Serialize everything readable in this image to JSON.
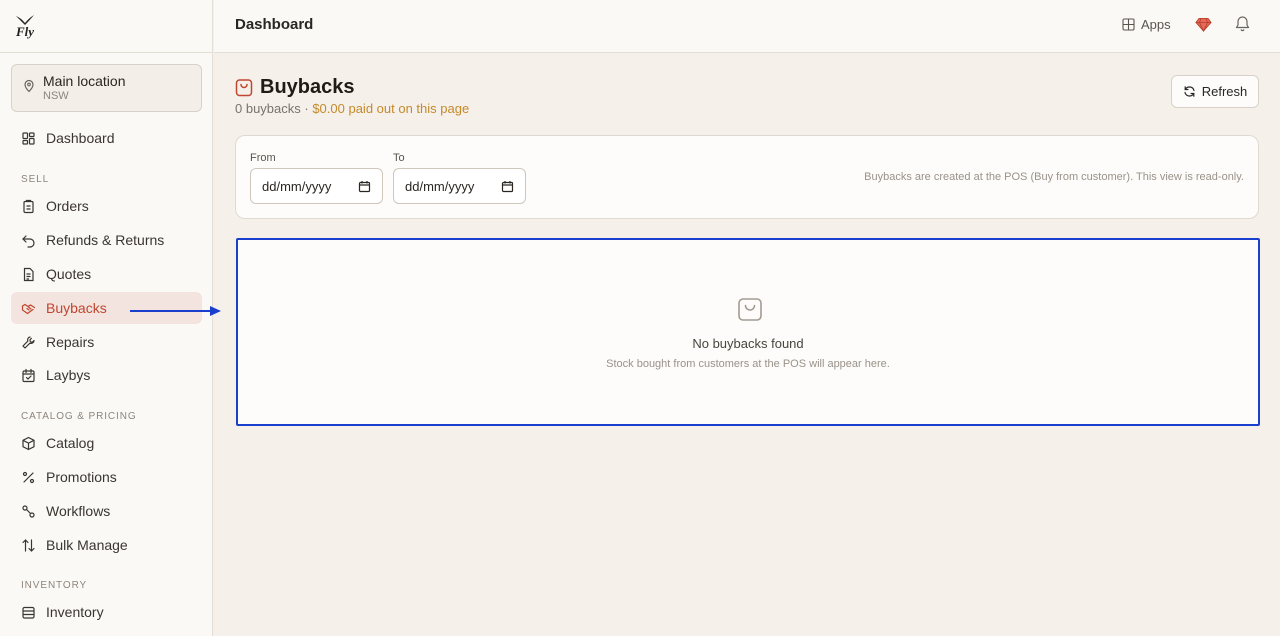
{
  "brand": {
    "logo_text": "Fly"
  },
  "location": {
    "name": "Main location",
    "region": "NSW"
  },
  "nav": {
    "dashboard": "Dashboard",
    "sell_label": "SELL",
    "orders": "Orders",
    "refunds": "Refunds & Returns",
    "quotes": "Quotes",
    "buybacks": "Buybacks",
    "repairs": "Repairs",
    "laybys": "Laybys",
    "catalog_label": "CATALOG & PRICING",
    "catalog": "Catalog",
    "promotions": "Promotions",
    "workflows": "Workflows",
    "bulk_manage": "Bulk Manage",
    "inventory_label": "INVENTORY",
    "inventory": "Inventory"
  },
  "topbar": {
    "title": "Dashboard",
    "apps_label": "Apps"
  },
  "page": {
    "title": "Buybacks",
    "count_text": "0 buybacks · ",
    "paid_text": "$0.00 paid out on this page",
    "refresh_label": "Refresh"
  },
  "filters": {
    "from_label": "From",
    "from_value": "dd/mm/yyyy",
    "to_label": "To",
    "to_value": "dd/mm/yyyy",
    "note": "Buybacks are created at the POS (Buy from customer). This view is read-only."
  },
  "empty": {
    "title": "No buybacks found",
    "subtitle": "Stock bought from customers at the POS will appear here."
  },
  "colors": {
    "accent": "#c0462f",
    "highlight": "#1a3fcc",
    "amount": "#c58a2a"
  }
}
